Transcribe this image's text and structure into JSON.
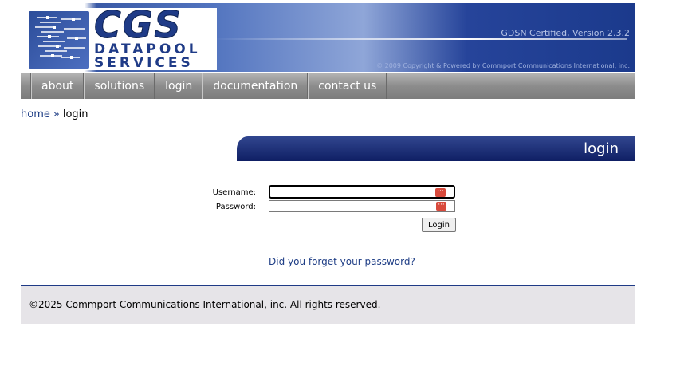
{
  "header": {
    "logo_big": "CGS",
    "logo_line1": "DATAPOOL",
    "logo_line2": "SERVICES",
    "certification": "GDSN Certified, Version 2.3.2",
    "copyright_small": "© 2009 Copyright & Powered by Commport Communications International, inc."
  },
  "nav": {
    "items": [
      {
        "label": "about"
      },
      {
        "label": "solutions"
      },
      {
        "label": "login"
      },
      {
        "label": "documentation"
      },
      {
        "label": "contact us"
      }
    ]
  },
  "breadcrumb": {
    "home": "home",
    "separator": "»",
    "current": "login"
  },
  "login_panel": {
    "title": "login",
    "username_label": "Username:",
    "password_label": "Password:",
    "username_value": "",
    "password_value": "",
    "submit_label": "Login",
    "forgot_link": "Did you forget your password?"
  },
  "footer": {
    "text": "©2025 Commport Communications International, inc. All rights reserved."
  },
  "icons": {
    "password_manager": "password-manager-icon"
  },
  "colors": {
    "brand_blue": "#1f3b87",
    "nav_gray": "#8c8c8c",
    "link_blue": "#1f3e86",
    "footer_bg": "#e6e4e8",
    "pw_icon_red": "#d84a3c"
  }
}
